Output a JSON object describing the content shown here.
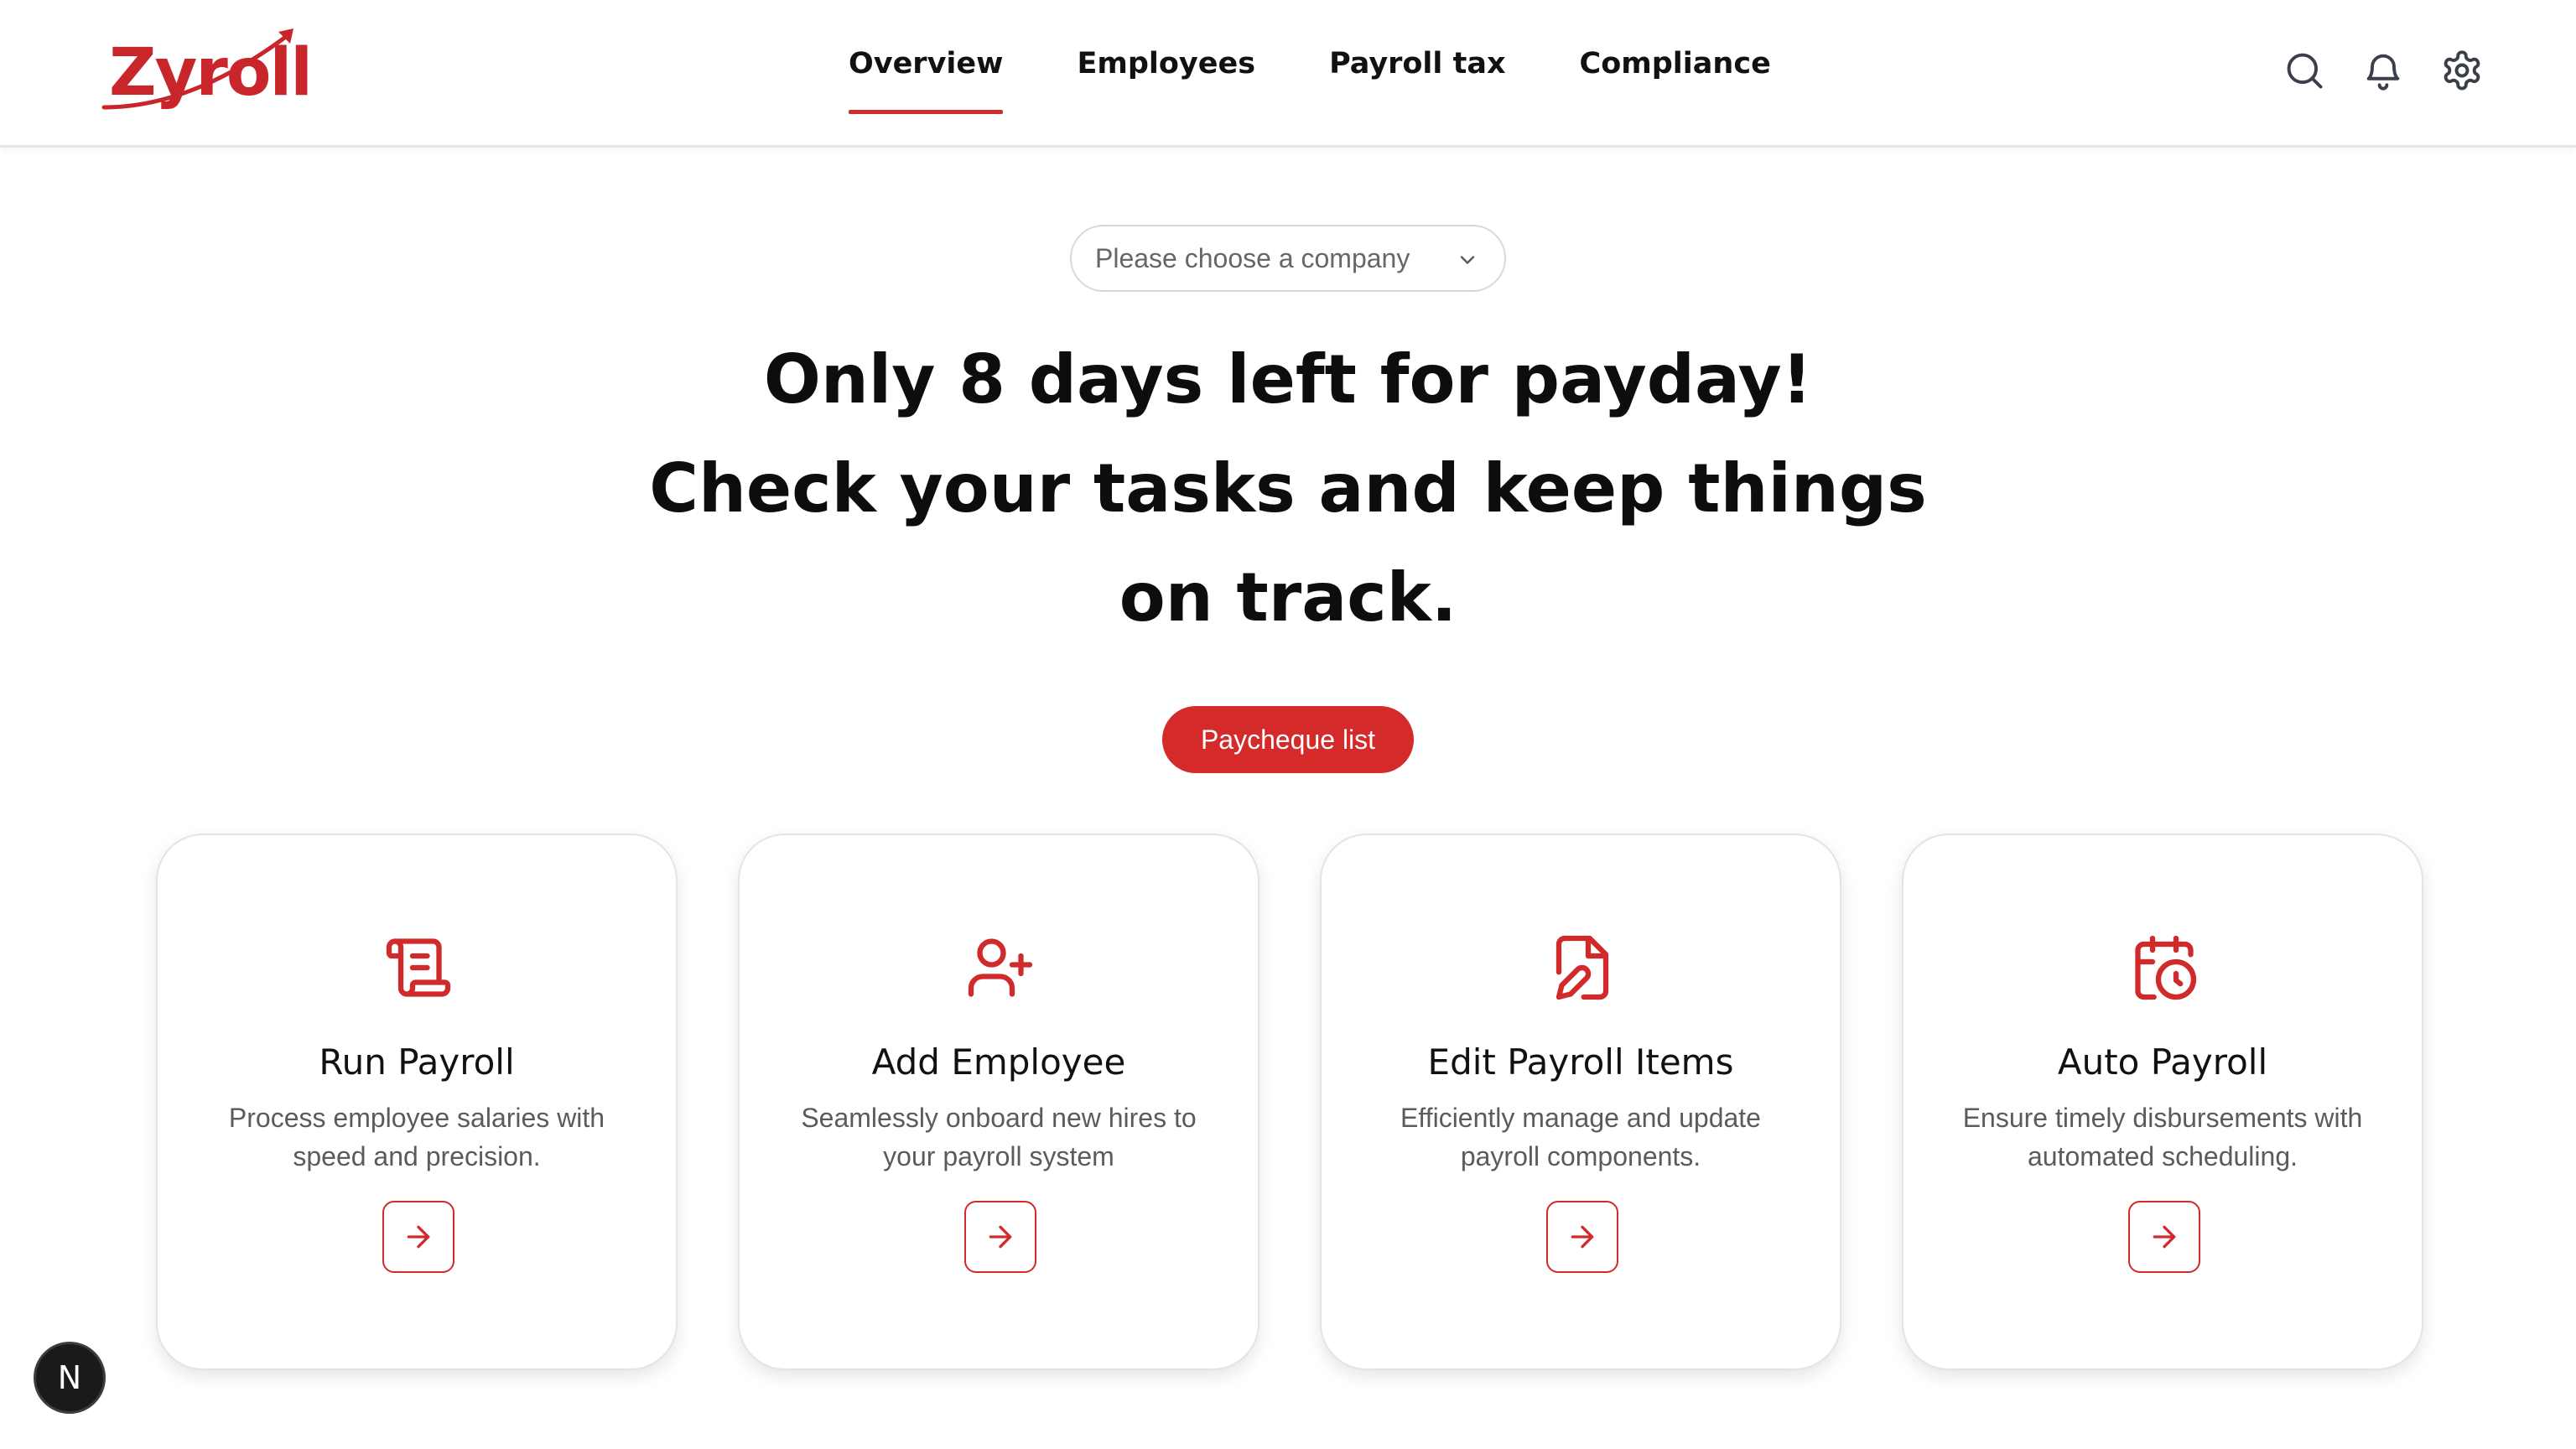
{
  "brand": {
    "name": "Zyroll",
    "color": "#c8262a"
  },
  "nav": {
    "items": [
      {
        "label": "Overview",
        "active": true
      },
      {
        "label": "Employees",
        "active": false
      },
      {
        "label": "Payroll tax",
        "active": false
      },
      {
        "label": "Compliance",
        "active": false
      }
    ]
  },
  "header_icons": [
    "search-icon",
    "bell-icon",
    "gear-icon"
  ],
  "company_select": {
    "placeholder": "Please choose a company"
  },
  "hero": {
    "line1": "Only 8 days left for payday!",
    "line2": "Check your tasks and keep things",
    "line3": "on track."
  },
  "cta": {
    "label": "Paycheque list"
  },
  "cards": [
    {
      "title": "Run Payroll",
      "desc": "Process employee salaries with speed and precision.",
      "icon": "scroll-icon"
    },
    {
      "title": "Add Employee",
      "desc": "Seamlessly onboard new hires to your payroll system",
      "icon": "user-plus-icon"
    },
    {
      "title": "Edit Payroll Items",
      "desc": "Efficiently manage and update payroll components.",
      "icon": "file-edit-icon"
    },
    {
      "title": "Auto Payroll",
      "desc": "Ensure timely disbursements with automated scheduling.",
      "icon": "calendar-clock-icon"
    }
  ],
  "badge": {
    "label": "N"
  },
  "colors": {
    "accent": "#d12a2a",
    "text": "#111111",
    "muted": "#5b5b5b"
  }
}
